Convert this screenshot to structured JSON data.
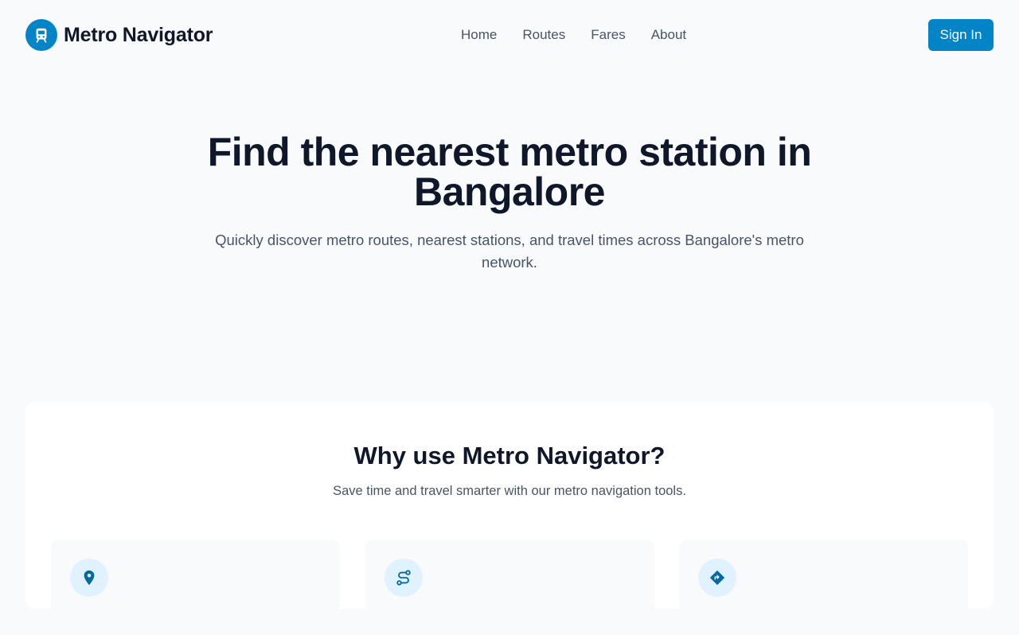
{
  "brand": {
    "name": "Metro Navigator",
    "logo_icon": "train-icon"
  },
  "nav": {
    "items": [
      "Home",
      "Routes",
      "Fares",
      "About"
    ]
  },
  "header": {
    "sign_in_label": "Sign In"
  },
  "hero": {
    "title": "Find the nearest metro station in Bangalore",
    "subtitle": "Quickly discover metro routes, nearest stations, and travel times across Bangalore's metro network."
  },
  "features": {
    "title": "Why use Metro Navigator?",
    "subtitle": "Save time and travel smarter with our metro navigation tools.",
    "items": [
      {
        "icon": "map-pin-icon"
      },
      {
        "icon": "route-icon"
      },
      {
        "icon": "directions-icon"
      }
    ]
  },
  "colors": {
    "accent": "#0284c7",
    "accent_light": "#e0f2fe",
    "text": "#0f172a",
    "muted": "#475569",
    "background": "#f8fafc"
  }
}
